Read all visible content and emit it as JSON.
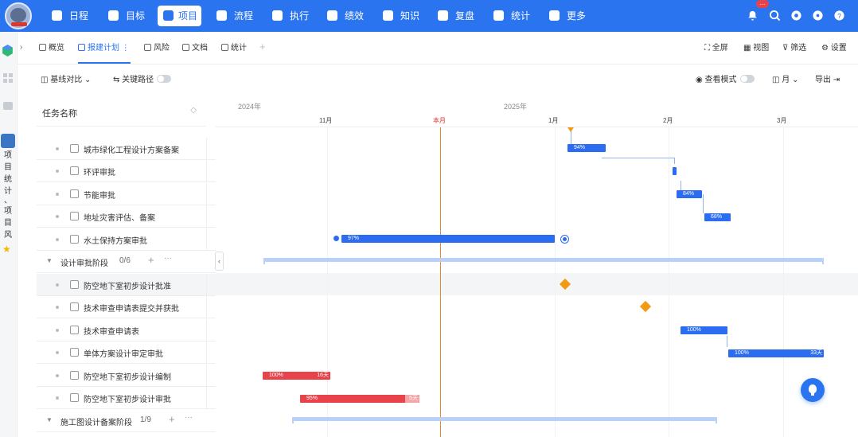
{
  "nav": {
    "badge": "...",
    "items": [
      {
        "label": "日程"
      },
      {
        "label": "目标"
      },
      {
        "label": "项目"
      },
      {
        "label": "流程"
      },
      {
        "label": "执行"
      },
      {
        "label": "绩效"
      },
      {
        "label": "知识"
      },
      {
        "label": "复盘"
      },
      {
        "label": "统计"
      },
      {
        "label": "更多"
      }
    ],
    "icons": [
      "bell-icon",
      "search-icon",
      "settings-icon",
      "gear-icon",
      "help-icon"
    ]
  },
  "rail": {
    "vertical_text": [
      "项",
      "目",
      "统",
      "计",
      "、",
      "项",
      "目",
      "风"
    ],
    "star": "★"
  },
  "tabs": [
    {
      "label": "概览"
    },
    {
      "label": "报建计划"
    },
    {
      "label": "风险"
    },
    {
      "label": "文档"
    },
    {
      "label": "统计"
    }
  ],
  "tab_more": "⋮",
  "tab_add": "+",
  "right_tools": [
    {
      "label": "全屏"
    },
    {
      "label": "视图"
    },
    {
      "label": "筛选"
    },
    {
      "label": "设置"
    }
  ],
  "toolbar": {
    "baseline": "基线对比",
    "critical_path": "关键路径",
    "view_mode": "查看模式",
    "scale": "月",
    "export": "导出"
  },
  "task_header": {
    "title": "任务名称",
    "sort": "◇"
  },
  "tasks": [
    {
      "kind": "task",
      "name": "城市绿化工程设计方案备案"
    },
    {
      "kind": "task",
      "name": "环评审批"
    },
    {
      "kind": "task",
      "name": "节能审批"
    },
    {
      "kind": "task",
      "name": "地址灾害评估、备案"
    },
    {
      "kind": "task",
      "name": "水土保持方案审批"
    },
    {
      "kind": "group",
      "name": "设计审批阶段",
      "count": "0/6",
      "plus": "+",
      "more": "···"
    },
    {
      "kind": "task",
      "name": "防空地下室初步设计批准"
    },
    {
      "kind": "task",
      "name": "技术审查申请表提交并获批"
    },
    {
      "kind": "task",
      "name": "技术审查申请表"
    },
    {
      "kind": "task",
      "name": "单体方案设计审定审批"
    },
    {
      "kind": "task",
      "name": "防空地下室初步设计编制"
    },
    {
      "kind": "task",
      "name": "防空地下室初步设计审批"
    },
    {
      "kind": "group",
      "name": "施工图设计备案阶段",
      "count": "1/9",
      "plus": "+",
      "more": "···"
    }
  ],
  "gantt": {
    "years": [
      "2024年",
      "2025年"
    ],
    "months": [
      "11月",
      "本月",
      "1月",
      "2月",
      "3月"
    ],
    "bars": [
      {
        "label": "94%",
        "tail": ""
      },
      {
        "label": "",
        "tail": ""
      },
      {
        "label": "84%",
        "tail": ""
      },
      {
        "label": "68%",
        "tail": ""
      },
      {
        "label": "97%",
        "tail": ""
      },
      {
        "label": "100%",
        "tail": ""
      },
      {
        "label": "100%",
        "tail": "33天"
      },
      {
        "label": "100%",
        "tail": "16天"
      },
      {
        "label": "95%",
        "tail": "5天"
      }
    ]
  },
  "colors": {
    "nav_bg": "#2b74f0",
    "bar_blue": "#2b6cf0",
    "bar_red": "#e8424a",
    "today": "#e58a2e",
    "milestone": "#f39a15"
  }
}
